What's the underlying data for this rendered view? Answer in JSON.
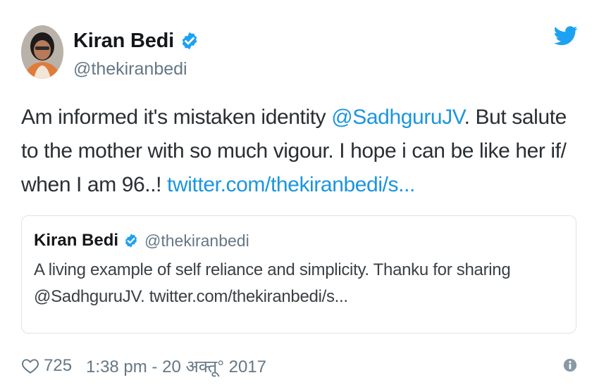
{
  "author": {
    "name": "Kiran Bedi",
    "handle": "@thekiranbedi",
    "verified_color": "#1da1f2"
  },
  "brand": {
    "icon": "twitter-bird-icon",
    "color": "#1da1f2"
  },
  "tweet": {
    "text_part1": "Am informed it's mistaken identity ",
    "mention": "@SadhguruJV",
    "text_part2": ". But salute to the mother with so much vigour. I hope i can be like her if/ when I am 96..! ",
    "link": "twitter.com/thekiranbedi/s..."
  },
  "quoted_tweet": {
    "name": "Kiran Bedi",
    "handle": "@thekiranbedi",
    "text": "A living example of self reliance and simplicity. Thanku for sharing @SadhguruJV. twitter.com/thekiranbedi/s..."
  },
  "footer": {
    "like_icon": "heart-icon",
    "likes": "725",
    "timestamp": "1:38 pm - 20 अक्तू° 2017",
    "info_icon": "info-icon"
  },
  "colors": {
    "link": "#1b95e0",
    "secondary_text": "#657786",
    "border": "#dde3e8"
  }
}
